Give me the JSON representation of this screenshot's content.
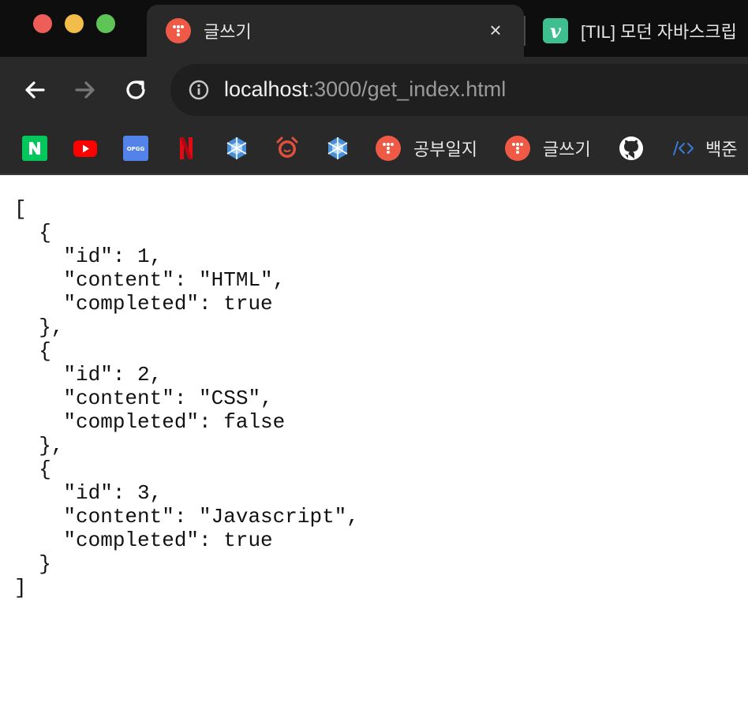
{
  "window": {
    "traffic_lights": {
      "close_color": "#ec5e57",
      "minimize_color": "#f2bd48",
      "zoom_color": "#5ec455"
    }
  },
  "tabs": [
    {
      "title": "글쓰기",
      "active": true,
      "favicon": "tistory-icon",
      "close_label": "×"
    },
    {
      "title": "[TIL] 모던 자바스크립",
      "active": false,
      "favicon": "velog-icon",
      "favicon_letter": "v"
    }
  ],
  "toolbar": {
    "back_icon": "arrow-left-icon",
    "forward_icon": "arrow-right-icon",
    "reload_icon": "reload-icon",
    "site_info_icon": "info-icon",
    "url_host": "localhost",
    "url_path": ":3000/get_index.html"
  },
  "bookmarks": [
    {
      "icon": "naver-icon",
      "label": "",
      "color": "#03c75a",
      "glyph": "N"
    },
    {
      "icon": "youtube-icon",
      "label": "",
      "color": "#ff0000"
    },
    {
      "icon": "opgg-icon",
      "label": "",
      "color": "#5383e8",
      "glyph": "OPGG"
    },
    {
      "icon": "netflix-icon",
      "label": "",
      "color": "#e50914",
      "glyph": "N"
    },
    {
      "icon": "snowflake-icon",
      "label": "",
      "color": "#4a90d9"
    },
    {
      "icon": "alarm-clock-icon",
      "label": "",
      "color": "#e0503a"
    },
    {
      "icon": "snowflake-icon",
      "label": "",
      "color": "#4a90d9"
    },
    {
      "icon": "tistory-icon",
      "label": "공부일지",
      "color": "#ef5a46"
    },
    {
      "icon": "tistory-icon",
      "label": "글쓰기",
      "color": "#ef5a46"
    },
    {
      "icon": "github-icon",
      "label": "",
      "color": "#ffffff"
    },
    {
      "icon": "code-icon",
      "label": "백준",
      "color": "#3a7bd5",
      "glyph": "/<>"
    }
  ],
  "content": {
    "json_text": "[\n  {\n    \"id\": 1,\n    \"content\": \"HTML\",\n    \"completed\": true\n  },\n  {\n    \"id\": 2,\n    \"content\": \"CSS\",\n    \"completed\": false\n  },\n  {\n    \"id\": 3,\n    \"content\": \"Javascript\",\n    \"completed\": true\n  }\n]"
  }
}
